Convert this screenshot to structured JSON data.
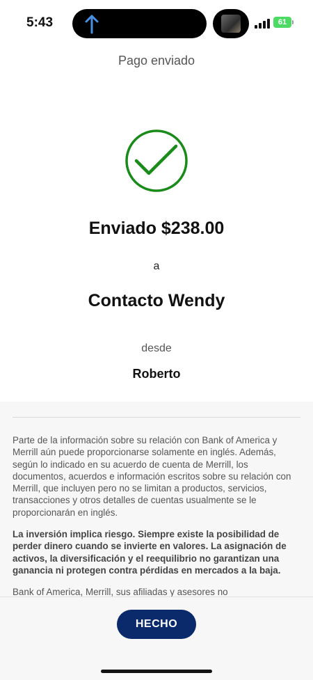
{
  "status_bar": {
    "time": "5:43",
    "battery": "61"
  },
  "header": {
    "title": "Pago enviado"
  },
  "confirmation": {
    "sent_amount": "Enviado $238.00",
    "to_label": "a",
    "recipient": "Contacto Wendy",
    "from_label": "desde",
    "sender": "Roberto"
  },
  "disclosure": {
    "paragraph1": "Parte de la información sobre su relación con Bank of America y Merrill aún puede proporcionarse solamente en inglés. Además, según lo indicado en su acuerdo de cuenta de Merrill, los documentos, acuerdos e información escritos sobre su relación con Merrill, que incluyen pero no se limitan a productos, servicios, transacciones y otros detalles de cuentas usualmente se le proporcionarán en inglés.",
    "paragraph2": "La inversión implica riesgo. Siempre existe la posibilidad de perder dinero cuando se invierte en valores. La asignación de activos, la diversificación y el reequilibrio no garantizan una ganancia ni protegen contra pérdidas en mercados a la baja.",
    "paragraph3": "Bank of America, Merrill, sus afiliadas y asesores no"
  },
  "footer": {
    "done_label": "HECHO"
  },
  "colors": {
    "success_green": "#1a8a1a",
    "button_navy": "#0b2a6b",
    "battery_green": "#4cd964"
  },
  "icons": [
    "upload-arrow-icon",
    "checkmark-circle-icon",
    "signal-icon",
    "battery-icon"
  ]
}
